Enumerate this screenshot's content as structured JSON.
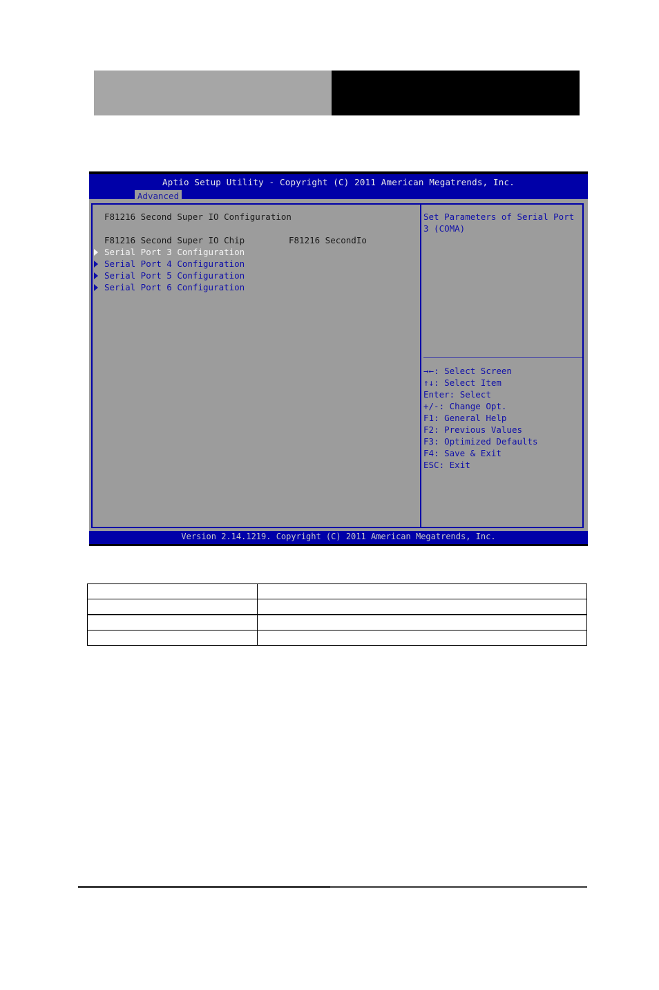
{
  "bios": {
    "title": "Aptio Setup Utility - Copyright (C) 2011 American Megatrends, Inc.",
    "tabs": [
      {
        "label": "Advanced",
        "active": true
      }
    ],
    "section_title": "F81216 Second Super IO Configuration",
    "chip": {
      "label": "F81216 Second Super IO Chip",
      "value": "F81216 SecondIo"
    },
    "menu_items": [
      {
        "label": "Serial Port 3 Configuration",
        "selected": true
      },
      {
        "label": "Serial Port 4 Configuration",
        "selected": false
      },
      {
        "label": "Serial Port 5 Configuration",
        "selected": false
      },
      {
        "label": "Serial Port 6 Configuration",
        "selected": false
      }
    ],
    "help_text": [
      "Set Parameters of Serial Port",
      "3 (COMA)"
    ],
    "key_help": [
      {
        "key": "→←:",
        "action": "Select Screen"
      },
      {
        "key": "↑↓:",
        "action": "Select Item"
      },
      {
        "key": "Enter:",
        "action": "Select"
      },
      {
        "key": "+/-:",
        "action": "Change Opt."
      },
      {
        "key": "F1:",
        "action": "General Help"
      },
      {
        "key": "F2:",
        "action": "Previous Values"
      },
      {
        "key": "F3:",
        "action": "Optimized Defaults"
      },
      {
        "key": "F4:",
        "action": "Save & Exit"
      },
      {
        "key": "ESC:",
        "action": "Exit"
      }
    ],
    "footer": "Version 2.14.1219. Copyright (C) 2011 American Megatrends, Inc.",
    "colors": {
      "title_bar": "#0000a8",
      "body": "#9c9c9c",
      "selected_text": "#f4f4f4",
      "item_text": "#1010a8"
    }
  },
  "doc_table": {
    "rows": [
      [
        "",
        ""
      ],
      [
        "",
        ""
      ],
      [
        "",
        ""
      ],
      [
        "",
        ""
      ]
    ]
  }
}
